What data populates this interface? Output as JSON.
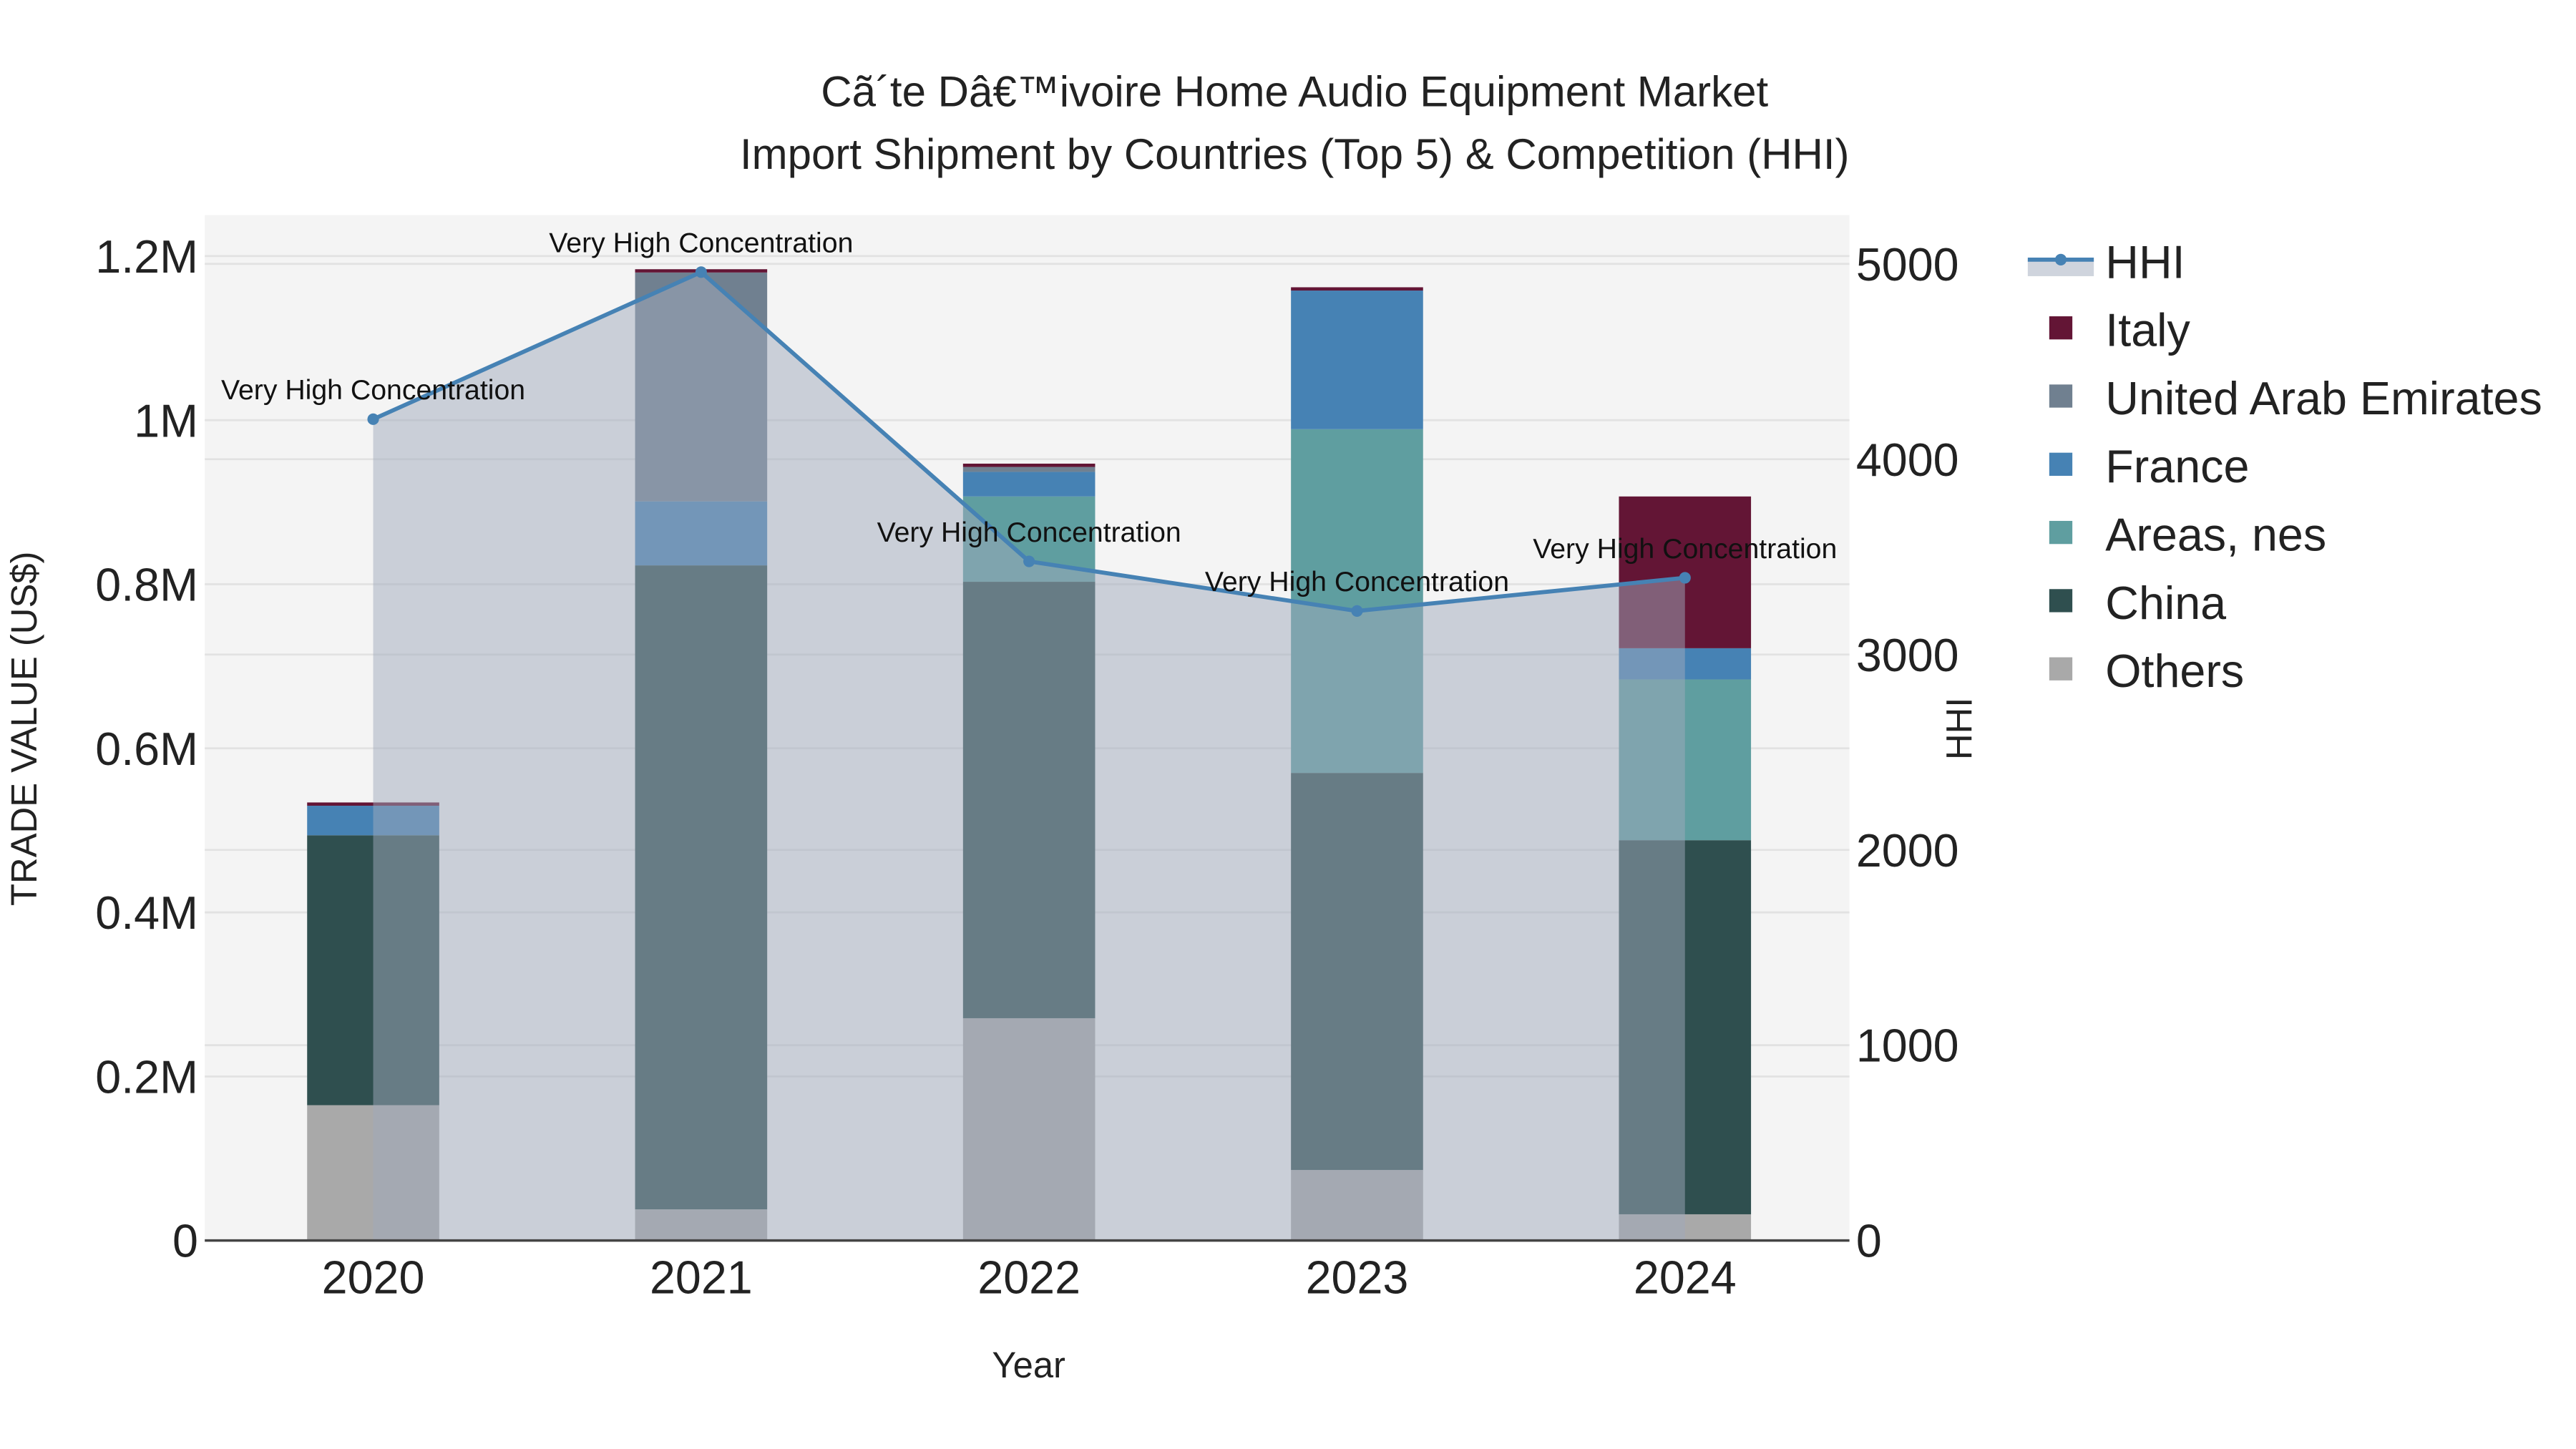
{
  "chart_data": {
    "type": "bar",
    "stacked": true,
    "title_line1": "Cã´te Dâ€™ivoire Home Audio Equipment Market",
    "title_line2": "Import Shipment by Countries (Top 5) & Competition (HHI)",
    "xlabel": "Year",
    "ylabel": "TRADE VALUE (US$)",
    "y2label": "HHI",
    "categories": [
      "2020",
      "2021",
      "2022",
      "2023",
      "2024"
    ],
    "ylim": [
      0,
      1250000
    ],
    "y2lim": [
      0,
      5250
    ],
    "yticks": [
      0,
      200000,
      400000,
      600000,
      800000,
      1000000,
      1200000
    ],
    "ytick_labels": [
      "0",
      "0.2M",
      "0.4M",
      "0.6M",
      "0.8M",
      "1M",
      "1.2M"
    ],
    "y2ticks": [
      0,
      1000,
      2000,
      3000,
      4000,
      5000
    ],
    "y2tick_labels": [
      "0",
      "1000",
      "2000",
      "3000",
      "4000",
      "5000"
    ],
    "grid": true,
    "legend_position": "right",
    "series": [
      {
        "name": "Others",
        "color": "#a9a9a9",
        "values": [
          165000,
          38000,
          271000,
          86000,
          32000
        ]
      },
      {
        "name": "China",
        "color": "#2f4f4f",
        "values": [
          329000,
          785000,
          532000,
          484000,
          456000
        ]
      },
      {
        "name": "Areas, nes",
        "color": "#5f9ea0",
        "values": [
          0,
          0,
          104000,
          419000,
          196000
        ]
      },
      {
        "name": "France",
        "color": "#4682b4",
        "values": [
          36000,
          78000,
          30000,
          169000,
          38000
        ]
      },
      {
        "name": "United Arab Emirates",
        "color": "#708090",
        "values": [
          0,
          279000,
          6000,
          0,
          0
        ]
      },
      {
        "name": "Italy",
        "color": "#631535",
        "values": [
          4000,
          4000,
          4000,
          4000,
          185000
        ]
      }
    ],
    "legend_order": [
      "HHI",
      "Italy",
      "United Arab Emirates",
      "France",
      "Areas, nes",
      "China",
      "Others"
    ],
    "hhi": {
      "name": "HHI",
      "color": "#4682b4",
      "values": [
        4205,
        4958,
        3477,
        3223,
        3393
      ],
      "annotations": [
        "Very High Concentration",
        "Very High Concentration",
        "Very High Concentration",
        "Very High Concentration",
        "Very High Concentration"
      ]
    }
  }
}
